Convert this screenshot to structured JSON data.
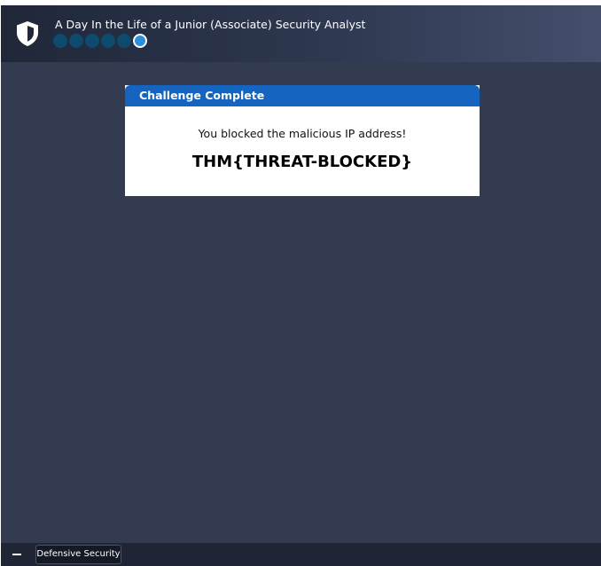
{
  "header": {
    "title": "A Day In the Life of a Junior (Associate) Security Analyst",
    "progress": {
      "total_steps": 6,
      "current_step": 6
    }
  },
  "modal": {
    "title": "Challenge Complete",
    "message": "You blocked the malicious IP address!",
    "flag": "THM{THREAT-BLOCKED}"
  },
  "taskbar": {
    "minimize_icon": "minus-icon",
    "tab_label": "Defensive Security"
  },
  "colors": {
    "background": "#323b50",
    "modal_header": "#1565c0",
    "step_inactive": "#0e4a6e",
    "step_active": "#2b8fd9"
  }
}
